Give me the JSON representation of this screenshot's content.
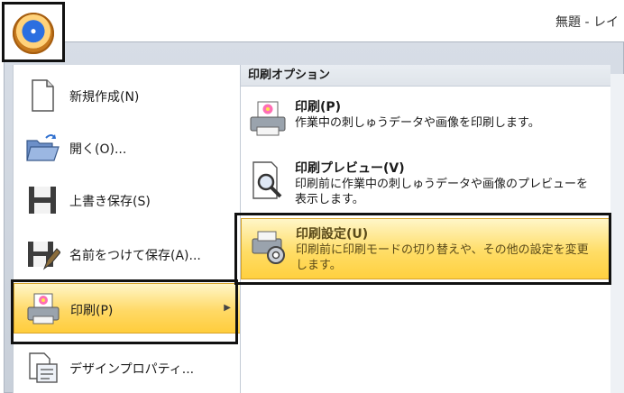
{
  "window": {
    "title": "無題 - レイ"
  },
  "left_menu": {
    "items": [
      {
        "label": "新規作成(N)",
        "icon": "new-document-icon"
      },
      {
        "label": "開く(O)...",
        "icon": "open-folder-icon"
      },
      {
        "label": "上書き保存(S)",
        "icon": "save-icon"
      },
      {
        "label": "名前をつけて保存(A)...",
        "icon": "save-as-icon"
      },
      {
        "label": "印刷(P)",
        "icon": "print-icon",
        "selected": true
      },
      {
        "label": "デザインプロパティ...",
        "icon": "design-properties-icon"
      }
    ]
  },
  "print_options": {
    "header": "印刷オプション",
    "items": [
      {
        "title": "印刷(P)",
        "desc": "作業中の刺しゅうデータや画像を印刷します。",
        "icon": "print-icon"
      },
      {
        "title": "印刷プレビュー(V)",
        "desc": "印刷前に作業中の刺しゅうデータや画像のプレビューを表示します。",
        "icon": "print-preview-icon"
      },
      {
        "title": "印刷設定(U)",
        "desc": "印刷前に印刷モードの切り替えや、その他の設定を変更します。",
        "icon": "print-settings-icon",
        "highlighted": true
      }
    ]
  },
  "colors": {
    "highlight": "#ffd966",
    "frame": "#111111",
    "menu_bg": "#d7dde6"
  }
}
